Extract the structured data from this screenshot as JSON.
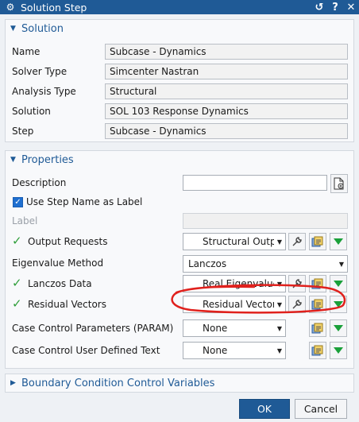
{
  "window": {
    "title": "Solution Step",
    "icon": "gear-icon",
    "buttons": [
      "reset-icon",
      "help-icon",
      "close-icon"
    ]
  },
  "colors": {
    "titlebar": "#1f5a96",
    "accent": "#1f5a96",
    "check": "#2f9e3a",
    "annotation": "#e0211d"
  },
  "solution": {
    "header": "Solution",
    "rows": [
      {
        "label": "Name",
        "value": "Subcase - Dynamics"
      },
      {
        "label": "Solver Type",
        "value": "Simcenter Nastran"
      },
      {
        "label": "Analysis Type",
        "value": "Structural"
      },
      {
        "label": "Solution",
        "value": "SOL 103 Response Dynamics"
      },
      {
        "label": "Step",
        "value": "Subcase - Dynamics"
      }
    ]
  },
  "properties": {
    "header": "Properties",
    "description_label": "Description",
    "description_value": "",
    "use_step_name_label": "Use Step Name as Label",
    "use_step_name_checked": true,
    "label_label": "Label",
    "output_requests_label": "Output Requests",
    "output_requests_value": "Structural Outpu",
    "eigenvalue_method_label": "Eigenvalue Method",
    "eigenvalue_method_value": "Lanczos",
    "lanczos_data_label": "Lanczos Data",
    "lanczos_data_value": "Real Eigenvalue",
    "residual_vectors_label": "Residual Vectors",
    "residual_vectors_value": "Residual Vectors",
    "case_control_param_label": "Case Control Parameters (PARAM)",
    "case_control_param_value": "None",
    "case_control_text_label": "Case Control User Defined Text",
    "case_control_text_value": "None"
  },
  "boundary": {
    "header": "Boundary Condition Control Variables"
  },
  "footer": {
    "ok": "OK",
    "cancel": "Cancel"
  }
}
